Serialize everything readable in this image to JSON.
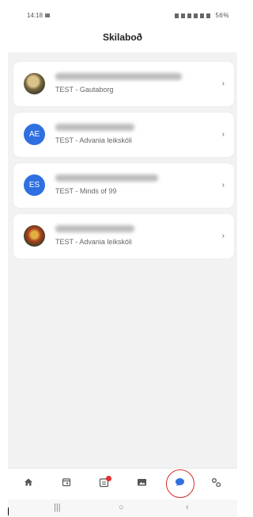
{
  "status_bar": {
    "time": "14:18",
    "battery": "56%"
  },
  "header": {
    "title": "Skilaboð"
  },
  "conversations": [
    {
      "avatar_type": "photo",
      "avatar_initials": "",
      "subtitle": "TEST - Gautaborg"
    },
    {
      "avatar_type": "initials",
      "avatar_initials": "AE",
      "subtitle": "TEST - Advania leikskóli"
    },
    {
      "avatar_type": "initials",
      "avatar_initials": "ES",
      "subtitle": "TEST - Minds of 99"
    },
    {
      "avatar_type": "photo",
      "avatar_initials": "",
      "subtitle": "TEST - Advania leikskóli"
    }
  ],
  "tabbar": {
    "items": [
      "home-icon",
      "calendar-icon",
      "attendance-icon",
      "photos-icon",
      "messages-icon",
      "settings-icon"
    ],
    "active": "messages-icon",
    "active_color": "#2f6fe0",
    "badge_color": "#e0302e"
  },
  "chevron": "›",
  "nav": {
    "recents": "|||",
    "home": "○",
    "back": "‹"
  }
}
